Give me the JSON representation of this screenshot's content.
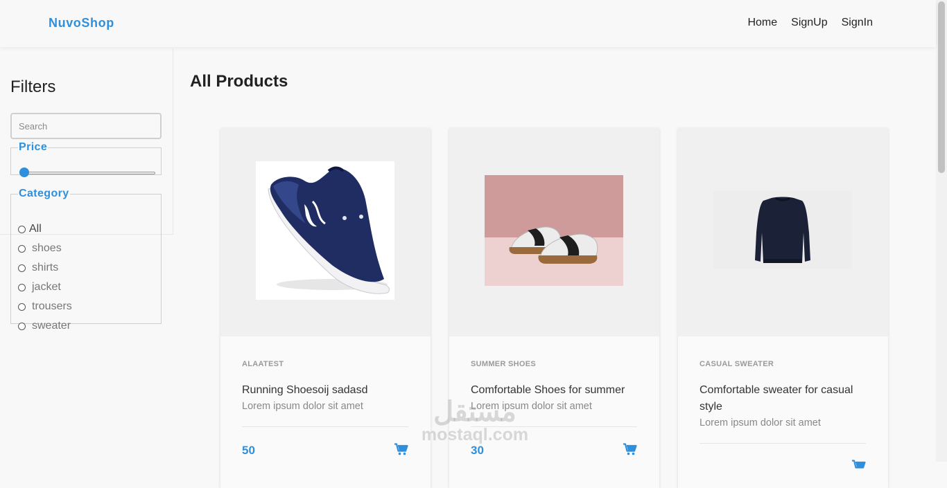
{
  "navbar": {
    "brand": "NuvoShop",
    "links": [
      {
        "label": "Home"
      },
      {
        "label": "SignUp"
      },
      {
        "label": "SignIn"
      }
    ],
    "brand_color": "#2f8fdc"
  },
  "sidebar": {
    "title": "Filters",
    "search": {
      "placeholder": "Search",
      "value": ""
    },
    "price": {
      "legend": "Price",
      "slider_value_fraction": 0.0
    },
    "category": {
      "legend": "Category",
      "options": [
        {
          "label": "All",
          "checked": false
        },
        {
          "label": "shoes",
          "checked": false
        },
        {
          "label": "shirts",
          "checked": false
        },
        {
          "label": "jacket",
          "checked": false
        },
        {
          "label": "trousers",
          "checked": false
        },
        {
          "label": "sweater",
          "checked": false
        }
      ]
    }
  },
  "main": {
    "title": "All Products",
    "products": [
      {
        "category": "ALAATEST",
        "title": "Running Shoesoij sadasd",
        "description": "Lorem ipsum dolor sit amet",
        "price": "50",
        "image": "navy-running-shoe"
      },
      {
        "category": "SUMMER SHOES",
        "title": "Comfortable Shoes for summer",
        "description": "Lorem ipsum dolor sit amet",
        "price": "30",
        "image": "white-sneakers-pink-background"
      },
      {
        "category": "CASUAL SWEATER",
        "title": "Comfortable sweater for casual style",
        "description": "Lorem ipsum dolor sit amet",
        "price": "",
        "image": "navy-sweater"
      }
    ]
  },
  "watermark": {
    "logo": "مستقل",
    "url": "mostaql.com"
  }
}
